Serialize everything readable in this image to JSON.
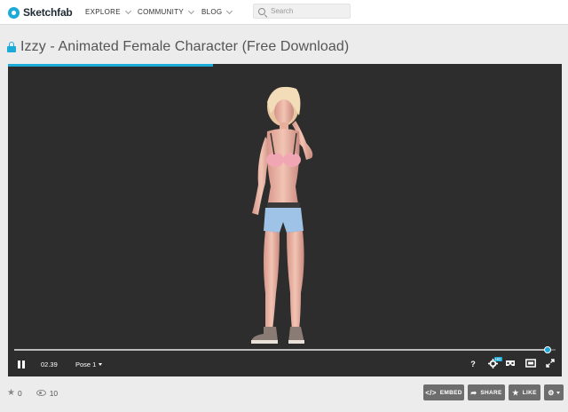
{
  "header": {
    "logo_text": "Sketchfab",
    "nav": [
      {
        "label": "EXPLORE"
      },
      {
        "label": "COMMUNITY"
      },
      {
        "label": "BLOG"
      }
    ],
    "search": {
      "placeholder": "Search",
      "value": ""
    }
  },
  "model": {
    "title": "Izzy - Animated Female Character (Free Download)"
  },
  "viewer": {
    "loading_progress": 0.37,
    "timeline_progress": 0.985,
    "time": "02.39",
    "animation": "Pose 1",
    "help_label": "?",
    "hd_badge": "HD"
  },
  "stats": {
    "likes": "0",
    "views": "10"
  },
  "actions": {
    "embed": "EMBED",
    "share": "SHARE",
    "like": "LIKE"
  },
  "colors": {
    "accent": "#1caad9",
    "viewer_bg": "#2d2d2d",
    "button_bg": "#6d6d6d"
  }
}
